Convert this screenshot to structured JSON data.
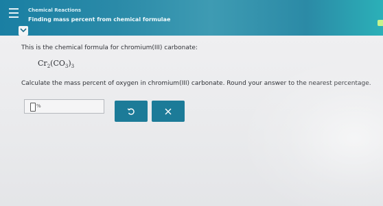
{
  "header": {
    "chapter": "Chemical Reactions",
    "topic": "Finding mass percent from chemical formulae"
  },
  "question": {
    "intro": "This is the chemical formula for chromium(III) carbonate:",
    "formula_el1": "Cr",
    "formula_sub1": "2",
    "formula_open": "(CO",
    "formula_sub2": "3",
    "formula_close": ")",
    "formula_sub3": "3",
    "prompt": "Calculate the mass percent of oxygen in chromium(III) carbonate. Round your answer to the nearest percentage."
  },
  "answer": {
    "value": "",
    "unit": "%"
  },
  "buttons": {
    "undo_icon": "undo-icon",
    "clear_icon": "close-icon"
  },
  "colors": {
    "header": "#1a7fa3",
    "button": "#1c7b98",
    "accent_tab": "#c7f38d"
  }
}
